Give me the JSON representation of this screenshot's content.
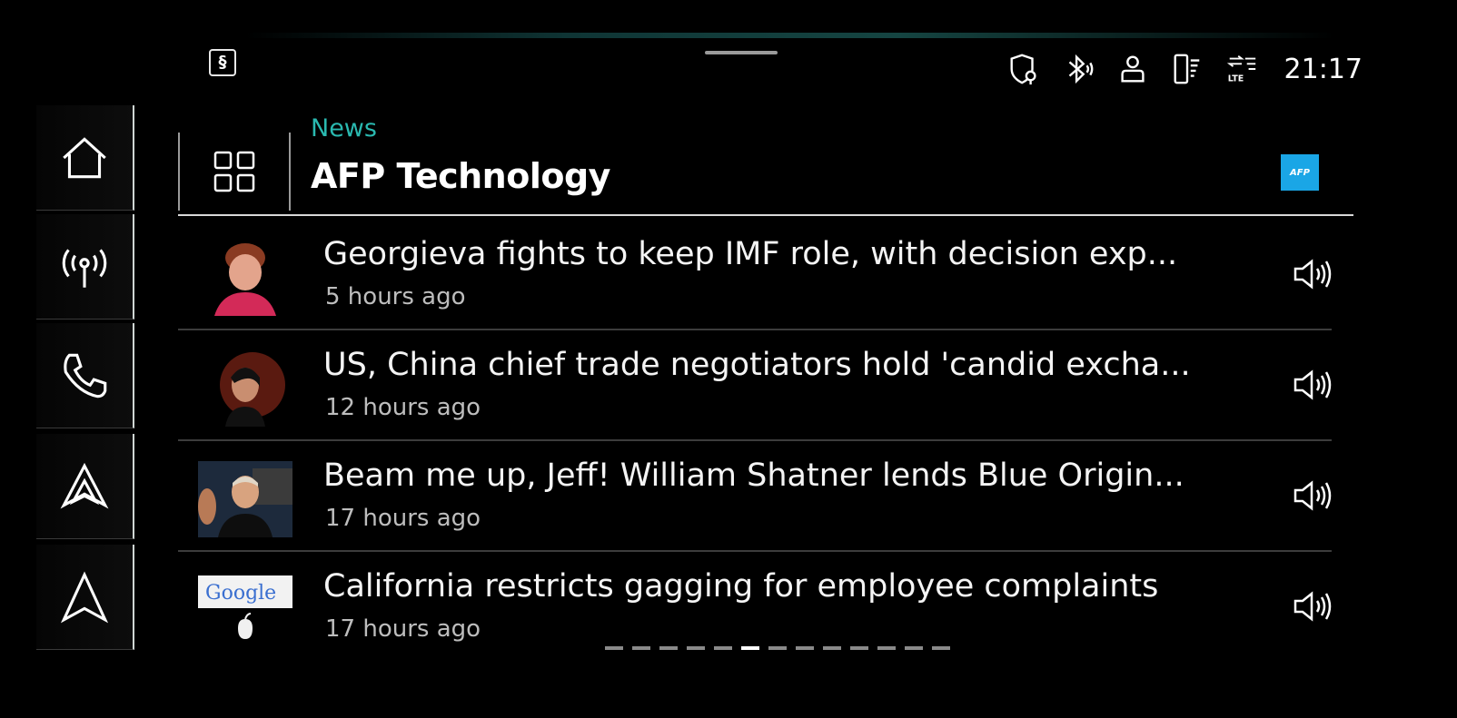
{
  "rail": {
    "items": [
      {
        "icon": "home-icon"
      },
      {
        "icon": "radio-icon"
      },
      {
        "icon": "phone-icon"
      },
      {
        "icon": "carplay-icon"
      },
      {
        "icon": "navigation-icon"
      }
    ]
  },
  "status": {
    "app_badge": "§",
    "clock": "21:17",
    "icons": [
      "location-privacy-icon",
      "bluetooth-icon",
      "user-icon",
      "phone-battery-icon",
      "lte-data-icon"
    ]
  },
  "header": {
    "category": "News",
    "title": "AFP Technology",
    "source_logo_text": "AFP",
    "accent_color": "#2ab9b0",
    "logo_color": "#1aa6e6"
  },
  "news": [
    {
      "headline": "Georgieva fights to keep IMF role, with decision exp...",
      "time": "5 hours ago",
      "thumb": "portrait-woman"
    },
    {
      "headline": "US, China chief trade negotiators hold 'candid excha...",
      "time": "12 hours ago",
      "thumb": "portrait-woman-dark"
    },
    {
      "headline": "Beam me up, Jeff! William Shatner lends Blue Origin...",
      "time": "17 hours ago",
      "thumb": "portrait-man-event"
    },
    {
      "headline": "California restricts gagging for employee complaints",
      "time": "17 hours ago",
      "thumb": "google-apple-logos",
      "thumb_text": "Google"
    }
  ],
  "pager": {
    "total": 13,
    "active_index": 5
  }
}
